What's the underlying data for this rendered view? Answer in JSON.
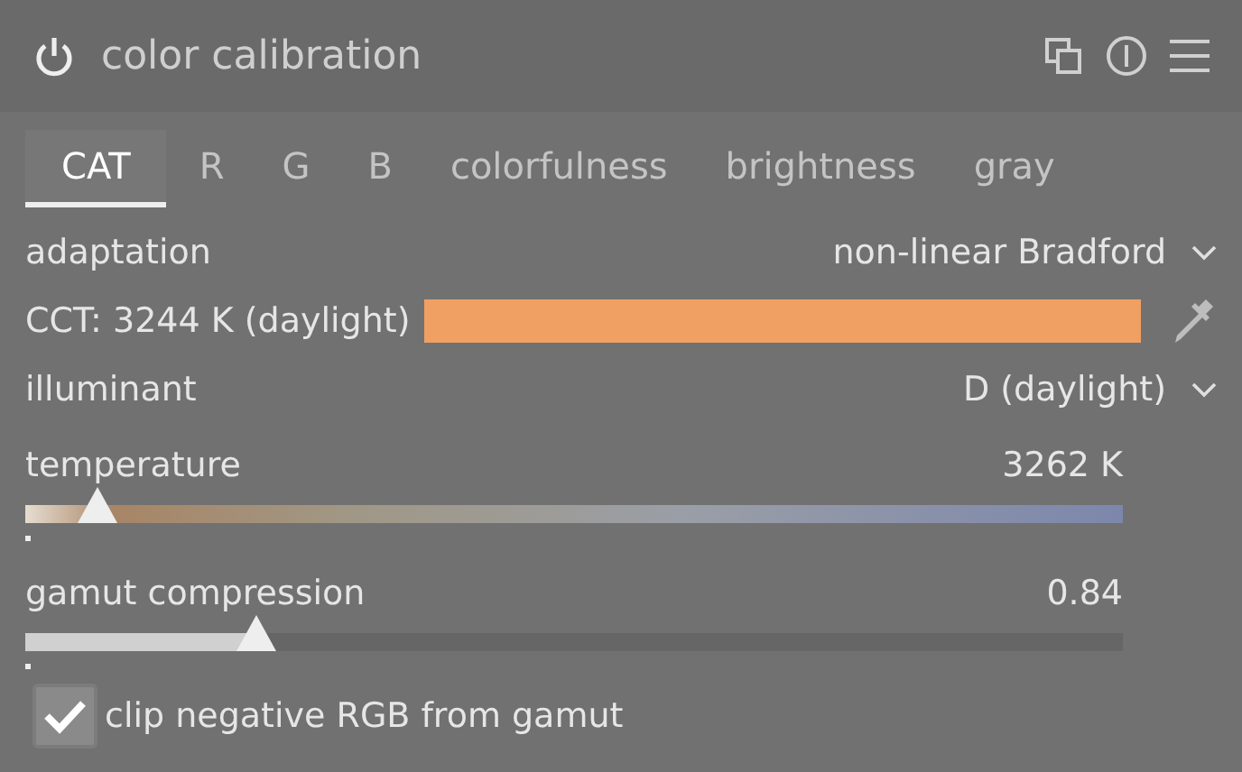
{
  "header": {
    "title": "color calibration",
    "enabled": true
  },
  "tabs": [
    {
      "label": "CAT",
      "selected": true
    },
    {
      "label": "R",
      "selected": false
    },
    {
      "label": "G",
      "selected": false
    },
    {
      "label": "B",
      "selected": false
    },
    {
      "label": "colorfulness",
      "selected": false
    },
    {
      "label": "brightness",
      "selected": false
    },
    {
      "label": "gray",
      "selected": false
    }
  ],
  "controls": [
    {
      "kind": "combo",
      "label": "adaptation",
      "value": "non-linear Bradford"
    },
    {
      "kind": "swatch",
      "label": "CCT: 3244 K (daylight)",
      "color": "#f0a062"
    },
    {
      "kind": "combo",
      "label": "illuminant",
      "value": "D (daylight)"
    },
    {
      "kind": "slider",
      "label": "temperature",
      "value": "3262 K",
      "level": 0.065,
      "gradient": true
    },
    {
      "kind": "slider",
      "label": "gamut compression",
      "value": "0.84",
      "level": 0.21,
      "gradient": false
    },
    {
      "kind": "checkbox",
      "label": "clip negative RGB from gamut",
      "checked": true
    }
  ]
}
